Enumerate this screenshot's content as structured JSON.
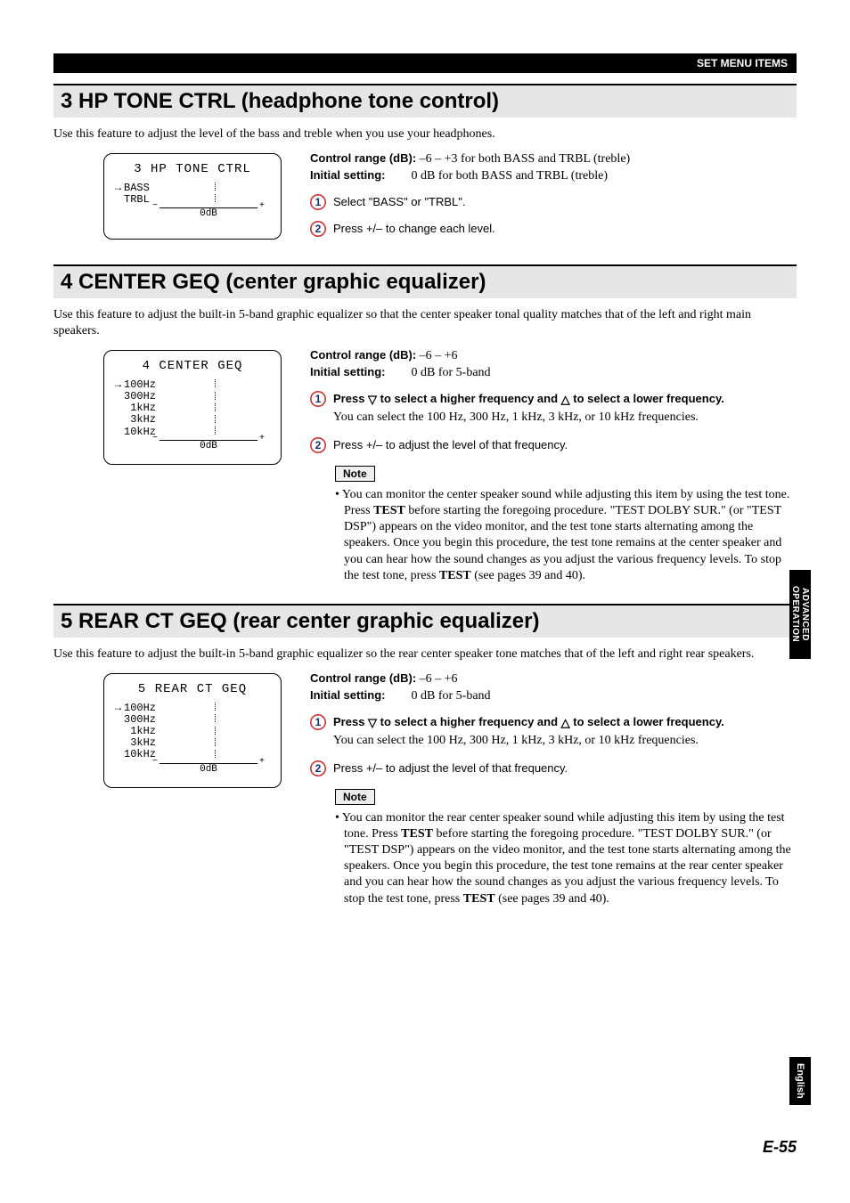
{
  "header_bar": "SET MENU ITEMS",
  "side_tab1": "ADVANCED\nOPERATION",
  "side_tab2": "English",
  "footer": "E-55",
  "sec3": {
    "heading": "3 HP TONE CTRL (headphone tone control)",
    "intro": "Use this feature to adjust the level of the bass and treble when you use your headphones.",
    "cr_label": "Control range (dB):",
    "cr_value": "–6 – +3 for both BASS and TRBL (treble)",
    "is_label": "Initial setting:",
    "is_value": "0 dB for both BASS and TRBL (treble)",
    "step1": "Select \"BASS\" or \"TRBL\".",
    "step2": "Press +/– to change each level.",
    "lcd_title": "3 HP TONE CTRL",
    "lcd_r1": "BASS",
    "lcd_r2": "TRBL",
    "lcd_zero": "0dB"
  },
  "sec4": {
    "heading": "4 CENTER GEQ (center graphic equalizer)",
    "intro": "Use this feature to adjust the built-in 5-band graphic equalizer so that the center speaker tonal quality matches that of the left and right main speakers.",
    "cr_label": "Control range (dB):",
    "cr_value": "–6 – +6",
    "is_label": "Initial setting:",
    "is_value": "0 dB for 5-band",
    "step1_a": "Press ",
    "step1_b": " to select a higher frequency and ",
    "step1_c": " to select a lower frequency.",
    "step1_sub": "You can select the 100 Hz, 300 Hz, 1 kHz, 3 kHz, or 10 kHz frequencies.",
    "step2": "Press +/– to adjust the level of that frequency.",
    "note_label": "Note",
    "note": "• You can monitor the center speaker sound while adjusting this item by using the test tone. Press TEST before starting the foregoing procedure. \"TEST DOLBY SUR.\" (or \"TEST DSP\") appears on the video monitor, and the test tone starts alternating among the speakers. Once you begin this procedure, the test tone remains at the center speaker and you can hear how the sound changes as you adjust the various frequency levels. To stop the test tone, press TEST (see pages 39 and 40).",
    "lcd_title": "4 CENTER GEQ",
    "lcd_r1": "100Hz",
    "lcd_r2": "300Hz",
    "lcd_r3": " 1kHz",
    "lcd_r4": " 3kHz",
    "lcd_r5": "10kHz",
    "lcd_zero": "0dB"
  },
  "sec5": {
    "heading": "5 REAR CT GEQ (rear center graphic equalizer)",
    "intro": "Use this feature to adjust the built-in 5-band graphic equalizer so the rear center speaker tone matches that of the left and right rear speakers.",
    "cr_label": "Control range (dB):",
    "cr_value": "–6 – +6",
    "is_label": "Initial setting:",
    "is_value": "0 dB for 5-band",
    "step1_a": "Press ",
    "step1_b": " to select a higher frequency and ",
    "step1_c": " to select a lower frequency.",
    "step1_sub": "You can select the 100 Hz, 300 Hz, 1 kHz, 3 kHz, or 10 kHz frequencies.",
    "step2": "Press +/– to adjust the level of that frequency.",
    "note_label": "Note",
    "note": "• You can monitor the rear center speaker sound while adjusting this item by using the test tone. Press TEST before starting the foregoing procedure. \"TEST DOLBY SUR.\" (or \"TEST DSP\") appears on the video monitor, and the test tone starts alternating among the speakers. Once you begin this procedure, the test tone remains at the rear center speaker and you can hear how the sound changes as you adjust the various frequency levels. To stop the test tone, press TEST (see pages 39 and 40).",
    "lcd_title": "5 REAR CT GEQ",
    "lcd_r1": "100Hz",
    "lcd_r2": "300Hz",
    "lcd_r3": " 1kHz",
    "lcd_r4": " 3kHz",
    "lcd_r5": "10kHz",
    "lcd_zero": "0dB"
  }
}
